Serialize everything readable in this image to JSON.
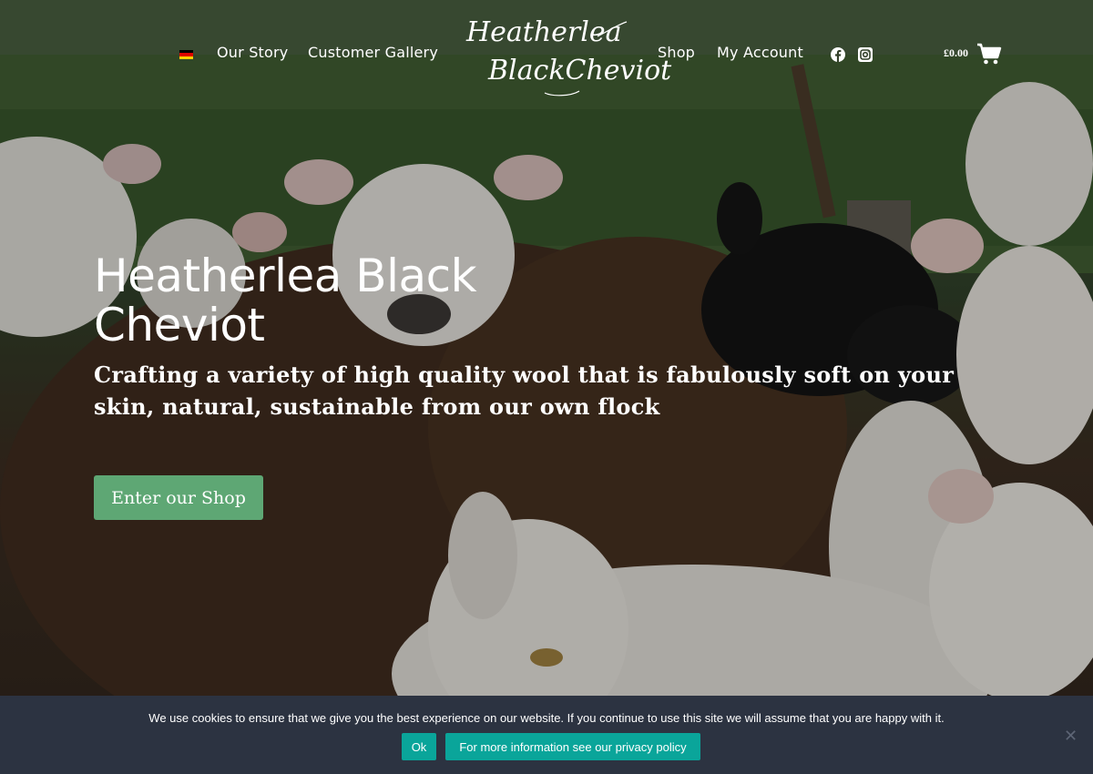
{
  "header": {
    "language_flag": "german-flag-icon",
    "nav_left": [
      {
        "label": "Our Story"
      },
      {
        "label": "Customer Gallery"
      }
    ],
    "logo": {
      "line1": "Heatherlea",
      "line2": "BlackCheviot"
    },
    "nav_right": [
      {
        "label": "Shop"
      },
      {
        "label": "My Account"
      }
    ],
    "social": [
      "facebook-icon",
      "instagram-icon"
    ],
    "cart_total": "£0.00"
  },
  "hero": {
    "title": "Heatherlea Black Cheviot",
    "subtitle": "Crafting a variety of high quality wool that is fabulously soft on your skin, natural, sustainable from our own flock",
    "cta_label": "Enter our Shop"
  },
  "cookie_bar": {
    "message": "We use cookies to ensure that we give you the best experience on our website. If you continue to use this site we will assume that you are happy with it.",
    "ok_label": "Ok",
    "privacy_label": "For more information see our privacy policy",
    "close_glyph": "✕"
  },
  "colors": {
    "cta": "#5ea774",
    "cookie_bg": "#2c3341",
    "cookie_button": "#0aa59a"
  }
}
